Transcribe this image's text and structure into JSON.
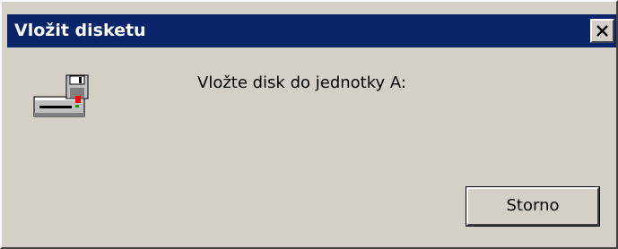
{
  "window": {
    "title": "Vložit disketu",
    "close_icon": "close-icon"
  },
  "body": {
    "icon": "floppy-drive-icon",
    "message": "Vložte disk do jednotky A:"
  },
  "buttons": {
    "cancel_label": "Storno"
  },
  "colors": {
    "titlebar": "#0a246a",
    "dialog_face": "#d4d0c8",
    "title_text": "#ffffff"
  }
}
